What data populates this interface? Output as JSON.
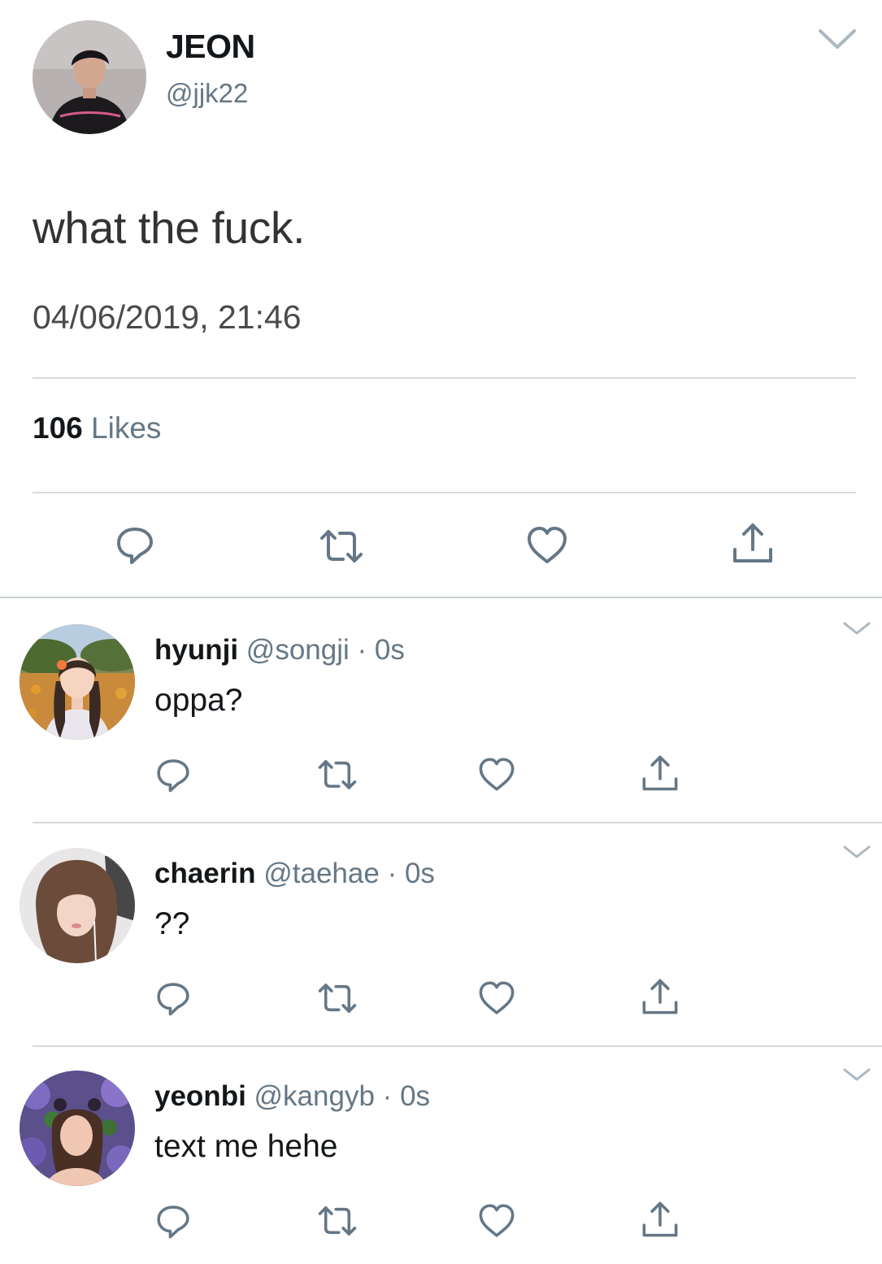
{
  "tweet": {
    "name": "JEON",
    "handle": "@jjk22",
    "text": "what the fuck.",
    "timestamp": "04/06/2019, 21:46",
    "likes_count": "106",
    "likes_label": "Likes"
  },
  "replies": [
    {
      "name": "hyunji",
      "handle": "@songji",
      "dot": "·",
      "time": "0s",
      "text": "oppa?"
    },
    {
      "name": "chaerin",
      "handle": "@taehae",
      "dot": "·",
      "time": "0s",
      "text": "??"
    },
    {
      "name": "yeonbi",
      "handle": "@kangyb",
      "dot": "·",
      "time": "0s",
      "text": "text me hehe"
    }
  ],
  "icons": {
    "reply": "speech-bubble",
    "retweet": "retweet-arrows",
    "like": "heart",
    "share": "share-upload",
    "menu": "chevron-down"
  },
  "colors": {
    "text": "#14171a",
    "secondary": "#657786",
    "icon": "#657786",
    "divider": "#d6dadd"
  }
}
